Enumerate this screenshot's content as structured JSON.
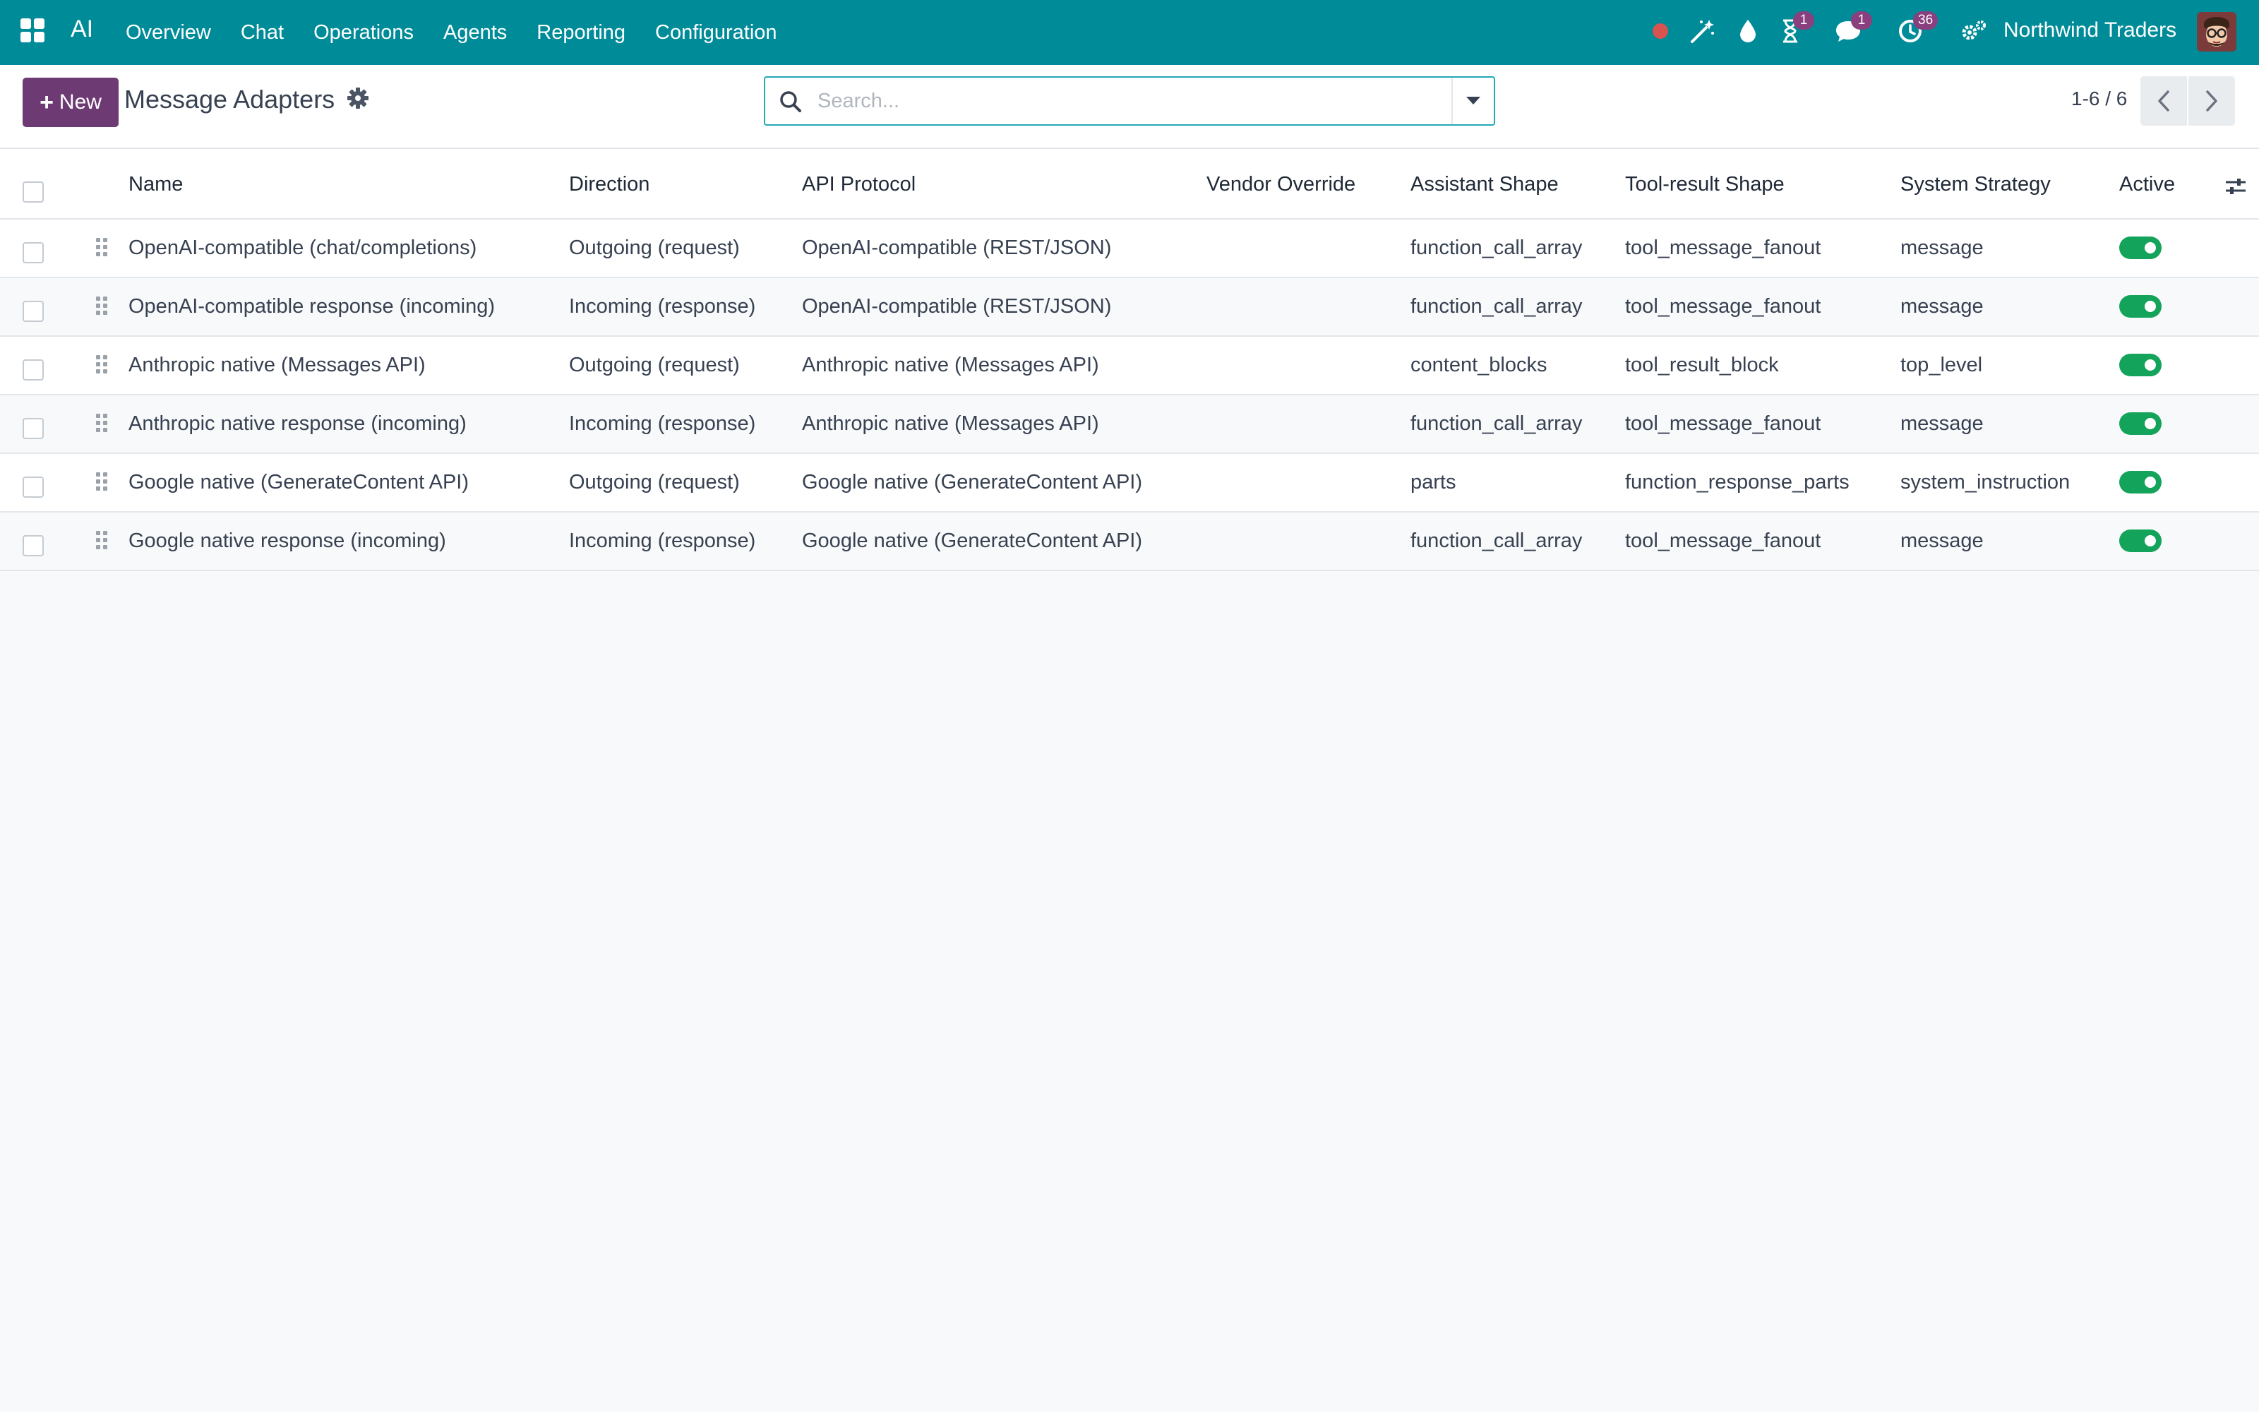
{
  "navbar": {
    "app_name": "AI",
    "menu": [
      "Overview",
      "Chat",
      "Operations",
      "Agents",
      "Reporting",
      "Configuration"
    ],
    "badges": {
      "activity": "1",
      "messages": "1",
      "timer": "36"
    },
    "company": "Northwind Traders"
  },
  "control_panel": {
    "new_label": "New",
    "title": "Message Adapters",
    "search_placeholder": "Search...",
    "pager": "1-6 / 6"
  },
  "table": {
    "columns": {
      "name": "Name",
      "direction": "Direction",
      "protocol": "API Protocol",
      "vendor": "Vendor Override",
      "assistant": "Assistant Shape",
      "tool": "Tool-result Shape",
      "system": "System Strategy",
      "active": "Active"
    },
    "rows": [
      {
        "name": "OpenAI-compatible (chat/completions)",
        "direction": "Outgoing (request)",
        "protocol": "OpenAI-compatible (REST/JSON)",
        "vendor": "",
        "assistant": "function_call_array",
        "tool": "tool_message_fanout",
        "system": "message",
        "active": true
      },
      {
        "name": "OpenAI-compatible response (incoming)",
        "direction": "Incoming (response)",
        "protocol": "OpenAI-compatible (REST/JSON)",
        "vendor": "",
        "assistant": "function_call_array",
        "tool": "tool_message_fanout",
        "system": "message",
        "active": true
      },
      {
        "name": "Anthropic native (Messages API)",
        "direction": "Outgoing (request)",
        "protocol": "Anthropic native (Messages API)",
        "vendor": "",
        "assistant": "content_blocks",
        "tool": "tool_result_block",
        "system": "top_level",
        "active": true
      },
      {
        "name": "Anthropic native response (incoming)",
        "direction": "Incoming (response)",
        "protocol": "Anthropic native (Messages API)",
        "vendor": "",
        "assistant": "function_call_array",
        "tool": "tool_message_fanout",
        "system": "message",
        "active": true
      },
      {
        "name": "Google native (GenerateContent API)",
        "direction": "Outgoing (request)",
        "protocol": "Google native (GenerateContent API)",
        "vendor": "",
        "assistant": "parts",
        "tool": "function_response_parts",
        "system": "system_instruction",
        "active": true
      },
      {
        "name": "Google native response (incoming)",
        "direction": "Incoming (response)",
        "protocol": "Google native (GenerateContent API)",
        "vendor": "",
        "assistant": "function_call_array",
        "tool": "tool_message_fanout",
        "system": "message",
        "active": true
      }
    ]
  },
  "colors": {
    "navbar": "#008b99",
    "primary_button": "#6e3a73",
    "badge": "#8a3f7e",
    "toggle_on": "#14a35a",
    "record_dot": "#d9534f"
  }
}
